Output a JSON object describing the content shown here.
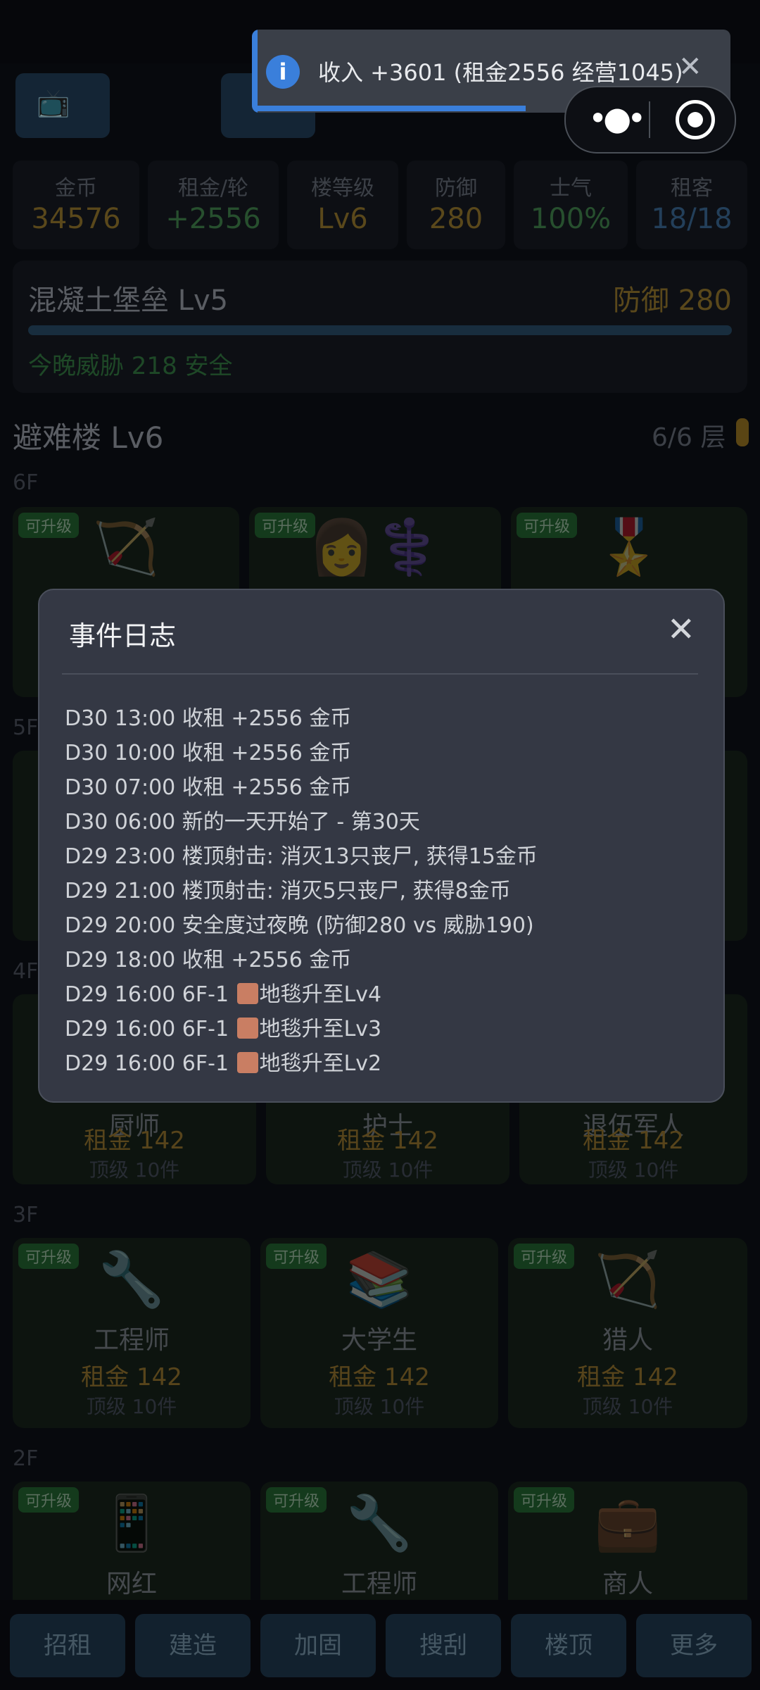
{
  "toast": {
    "message": "收入 +3601 (租金2556 经营1045)",
    "progress": 0.56
  },
  "header": {
    "tv_icon": "📺",
    "stats": [
      {
        "label": "金币",
        "value": "34576",
        "color": "#8a6f2a"
      },
      {
        "label": "租金/轮",
        "value": "+2556",
        "color": "#3c7a47"
      },
      {
        "label": "楼等级",
        "value": "Lv6",
        "color": "#8a6f2a"
      },
      {
        "label": "防御",
        "value": "280",
        "color": "#8a6f2a"
      },
      {
        "label": "士气",
        "value": "100%",
        "color": "#3c7a47"
      },
      {
        "label": "租客",
        "value": "18/18",
        "color": "#36628a"
      }
    ]
  },
  "fortress": {
    "name": "混凝土堡垒 Lv5",
    "defense": "防御 280",
    "threat": "今晚威胁 218 安全"
  },
  "building": {
    "title": "避难楼 Lv6",
    "floors": "6/6 层"
  },
  "floors": [
    {
      "label": "6F",
      "rooms": [
        {
          "badge": "可升级",
          "emoji": "🏹"
        },
        {
          "badge": "可升级",
          "emoji": "👩⚕️"
        },
        {
          "badge": "可升级",
          "emoji": "🎖️"
        }
      ]
    },
    {
      "label": "5F"
    },
    {
      "label": "4F",
      "rooms": [
        {
          "role": "厨师",
          "rent": "租金 142",
          "top": "顶级 10件"
        },
        {
          "role": "护士",
          "rent": "租金 142",
          "top": "顶级 10件"
        },
        {
          "role": "退伍军人",
          "rent": "租金 142",
          "top": "顶级 10件"
        }
      ]
    },
    {
      "label": "3F",
      "rooms": [
        {
          "badge": "可升级",
          "emoji": "🔧",
          "role": "工程师",
          "rent": "租金 142",
          "top": "顶级 10件"
        },
        {
          "badge": "可升级",
          "emoji": "📚",
          "role": "大学生",
          "rent": "租金 142",
          "top": "顶级 10件"
        },
        {
          "badge": "可升级",
          "emoji": "🏹",
          "role": "猎人",
          "rent": "租金 142",
          "top": "顶级 10件"
        }
      ]
    },
    {
      "label": "2F",
      "rooms": [
        {
          "badge": "可升级",
          "emoji": "📱",
          "role": "网红"
        },
        {
          "badge": "可升级",
          "emoji": "🔧",
          "role": "工程师"
        },
        {
          "badge": "可升级",
          "emoji": "💼",
          "role": "商人"
        }
      ]
    }
  ],
  "bottom_nav": [
    "招租",
    "建造",
    "加固",
    "搜刮",
    "楼顶",
    "更多"
  ],
  "modal": {
    "title": "事件日志",
    "lines": [
      {
        "text": "D30 13:00 收租 +2556 金币"
      },
      {
        "text": "D30 10:00 收租 +2556 金币"
      },
      {
        "text": "D30 07:00 收租 +2556 金币"
      },
      {
        "text": "D30 06:00 新的一天开始了 - 第30天"
      },
      {
        "text": "D29 23:00 楼顶射击: 消灭13只丧尸, 获得15金币"
      },
      {
        "text": "D29 21:00 楼顶射击: 消灭5只丧尸, 获得8金币"
      },
      {
        "text": "D29 20:00 安全度过夜晚 (防御280 vs 威胁190)"
      },
      {
        "text": "D29 18:00 收租 +2556 金币"
      },
      {
        "prefix": "D29 16:00 6F-1 ",
        "suffix": "地毯升至Lv4"
      },
      {
        "prefix": "D29 16:00 6F-1 ",
        "suffix": "地毯升至Lv3"
      },
      {
        "prefix": "D29 16:00 6F-1 ",
        "suffix": "地毯升至Lv2"
      }
    ]
  }
}
